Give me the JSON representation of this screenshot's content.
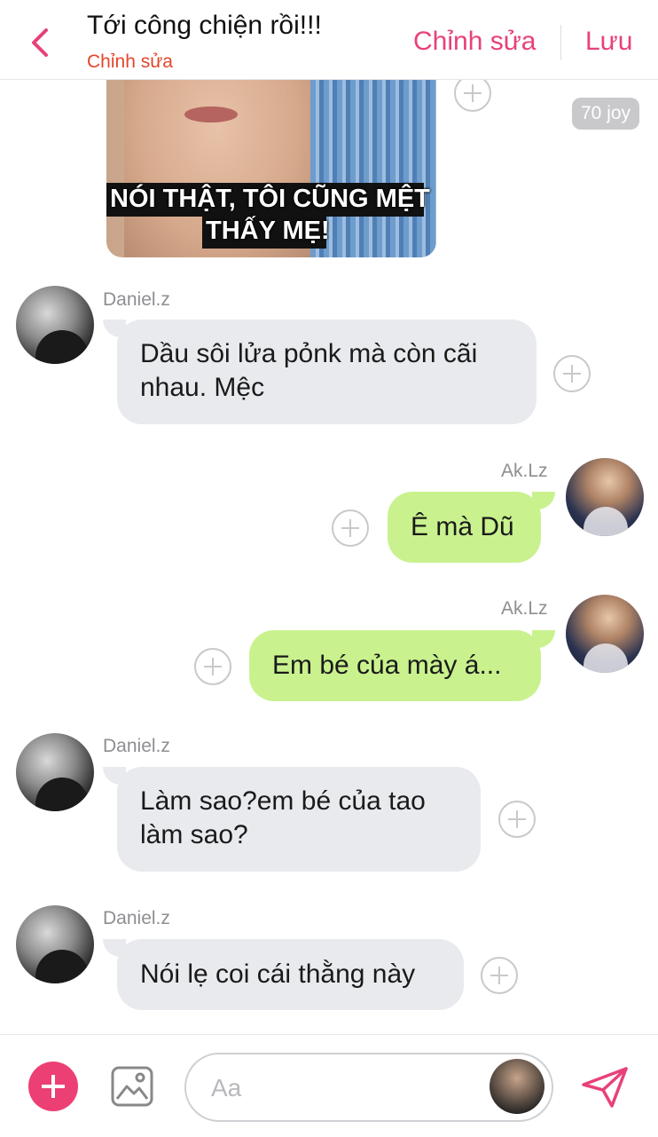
{
  "header": {
    "title": "Tới công chiện rồi!!!",
    "subtitle": "Chỉnh sửa",
    "edit_label": "Chỉnh sửa",
    "save_label": "Lưu"
  },
  "colors": {
    "accent": "#e8417a",
    "subtitle": "#e2462b",
    "bubble_in": "#e9eaee",
    "bubble_out": "#c9f28e",
    "add_button": "#ec3f74"
  },
  "sticker": {
    "caption_line1": "NÓI THẬT, TÔI CŨNG MỆT",
    "caption_line2": "THẤY MẸ!",
    "joy_badge": "70 joy"
  },
  "messages": [
    {
      "sender": "Daniel.z",
      "direction": "in",
      "text_line1": "Dầu sôi lửa pỏnk mà còn cãi",
      "text_line2": "nhau. Mệc"
    },
    {
      "sender": "Ak.Lz",
      "direction": "out",
      "text_line1": "Ê mà Dũ"
    },
    {
      "sender": "Ak.Lz",
      "direction": "out",
      "text_line1": "Em bé của mày á..."
    },
    {
      "sender": "Daniel.z",
      "direction": "in",
      "text_line1": "Làm sao?em bé của tao",
      "text_line2": "làm sao?"
    },
    {
      "sender": "Daniel.z",
      "direction": "in",
      "text_line1": "Nói lẹ coi cái thằng này"
    }
  ],
  "input": {
    "placeholder": "Aa"
  },
  "icons": {
    "back": "chevron-left-icon",
    "add": "plus-icon",
    "image": "image-icon",
    "send": "send-icon",
    "reaction": "add-reaction-icon"
  }
}
